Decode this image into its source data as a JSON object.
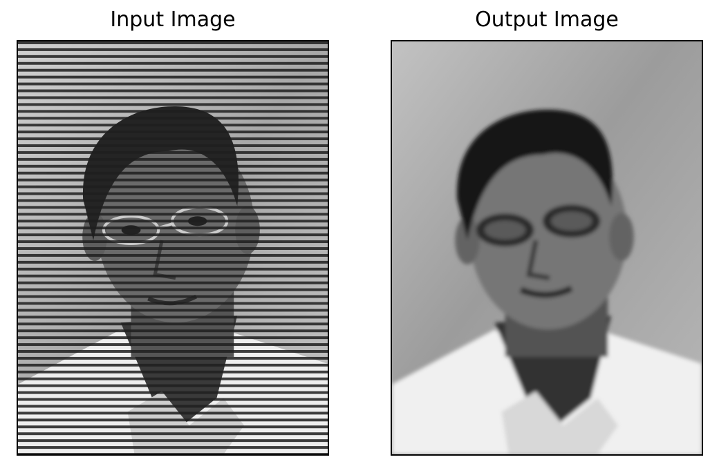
{
  "panels": {
    "input": {
      "title": "Input Image"
    },
    "output": {
      "title": "Output Image"
    }
  },
  "colors": {
    "background": "#ffffff",
    "frame": "#000000",
    "photo_bg_light": "#bdbdbd",
    "photo_bg_mid": "#9a9a9a",
    "hair": "#1a1a1a",
    "skin": "#6e6e6e",
    "shirt": "#f2f2f2",
    "scanline": "#202020"
  }
}
